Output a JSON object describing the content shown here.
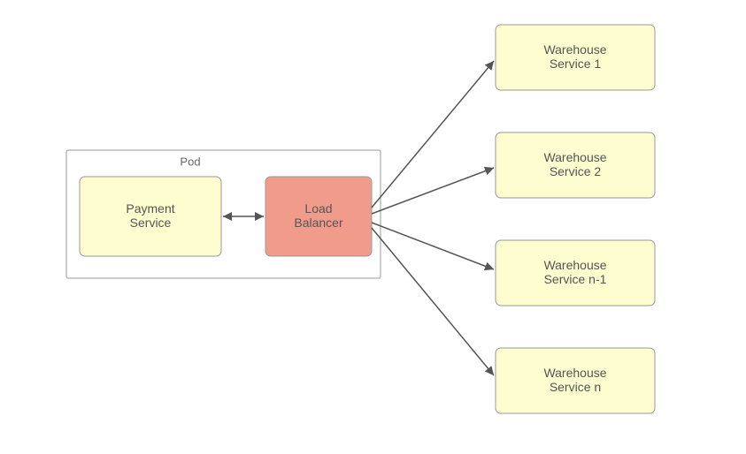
{
  "diagram": {
    "pod_label": "Pod",
    "payment_service": "Payment\nService",
    "load_balancer": "Load\nBalancer",
    "warehouse_1": "Warehouse\nService 1",
    "warehouse_2": "Warehouse\nService 2",
    "warehouse_n_minus_1": "Warehouse\nService n-1",
    "warehouse_n": "Warehouse\nService n"
  },
  "colors": {
    "yellow_fill": "#fdfdd0",
    "red_fill": "#f19b8b",
    "border": "#999999"
  },
  "edges": [
    {
      "from": "payment_service",
      "to": "load_balancer",
      "bidirectional": true
    },
    {
      "from": "load_balancer",
      "to": "warehouse_1",
      "bidirectional": false
    },
    {
      "from": "load_balancer",
      "to": "warehouse_2",
      "bidirectional": false
    },
    {
      "from": "load_balancer",
      "to": "warehouse_n_minus_1",
      "bidirectional": false
    },
    {
      "from": "load_balancer",
      "to": "warehouse_n",
      "bidirectional": false
    }
  ]
}
